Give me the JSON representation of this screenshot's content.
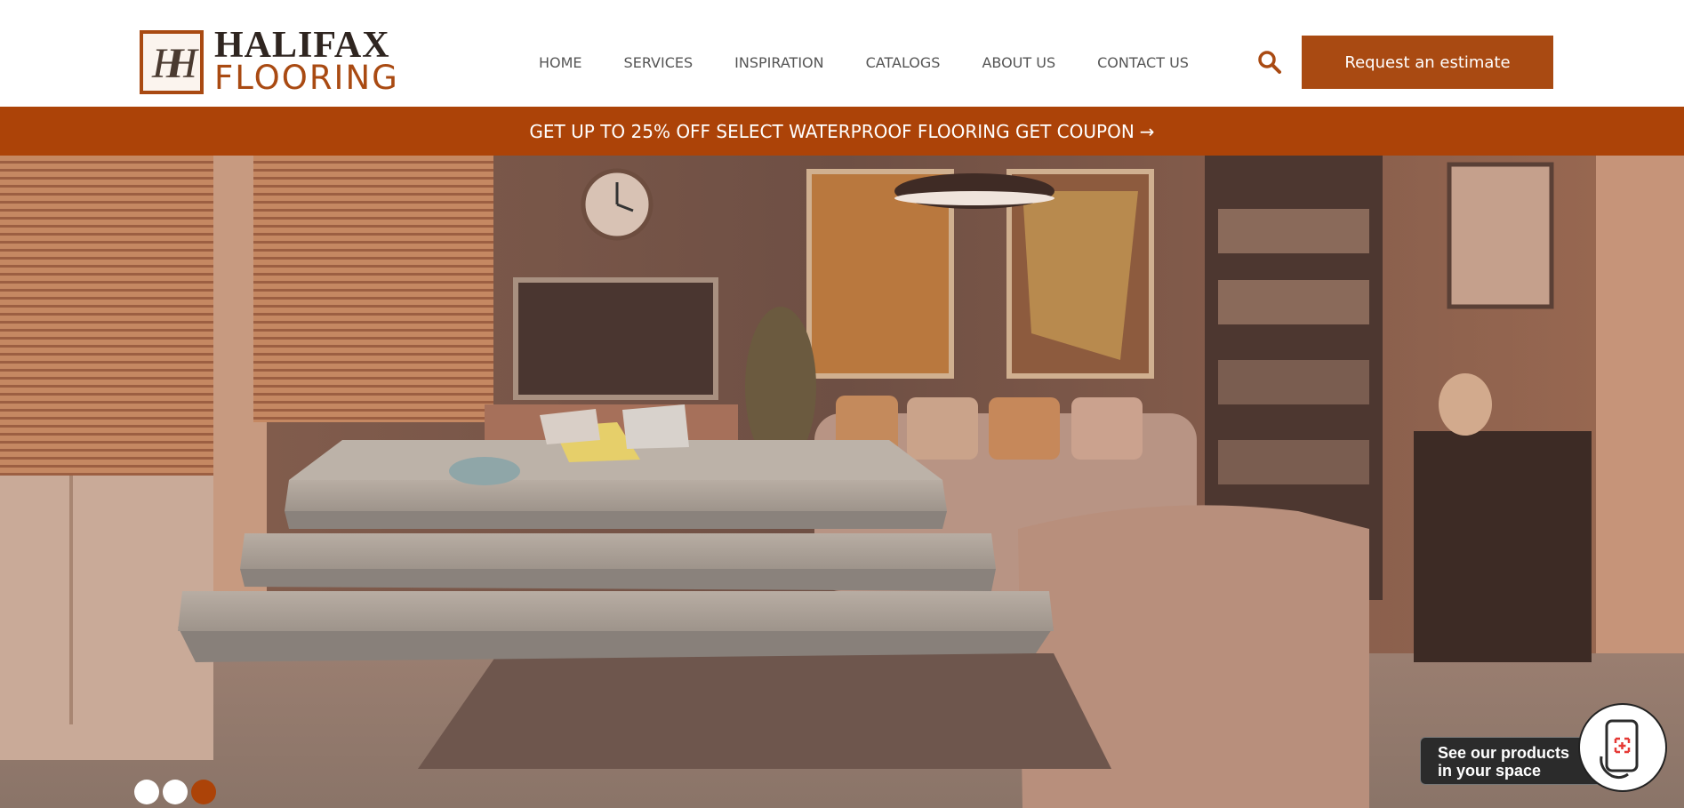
{
  "brand": {
    "monogram": "H",
    "name_line1": "HALIFAX",
    "name_line2": "FLOORING",
    "accent_color": "#ac4308"
  },
  "nav": {
    "items": [
      {
        "label": "HOME"
      },
      {
        "label": "SERVICES"
      },
      {
        "label": "INSPIRATION"
      },
      {
        "label": "CATALOGS"
      },
      {
        "label": "ABOUT US"
      },
      {
        "label": "CONTACT US"
      }
    ]
  },
  "header": {
    "search_icon": "search-icon",
    "estimate_label": "Request an estimate"
  },
  "promo": {
    "text": "GET UP TO 25% OFF SELECT WATERPROOF FLOORING GET COUPON",
    "arrow": "→"
  },
  "hero": {
    "slide_count": 3,
    "active_slide": 3
  },
  "ar_widget": {
    "line1": "See our products",
    "line2": "in your space",
    "icon": "phone-ar-icon"
  }
}
